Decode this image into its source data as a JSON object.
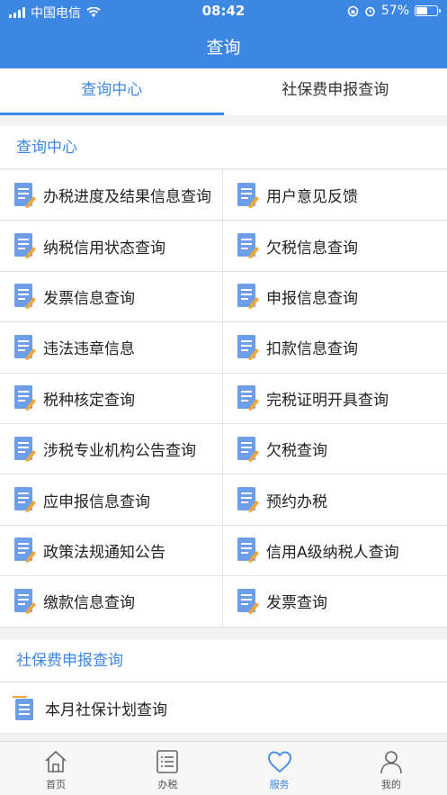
{
  "status_bar": {
    "carrier": "中国电信",
    "time": "08:42",
    "battery": "57%",
    "battery_level": 0.57
  },
  "header": {
    "title": "查询"
  },
  "tabs": [
    {
      "label": "查询中心",
      "active": true
    },
    {
      "label": "社保费申报查询",
      "active": false
    }
  ],
  "section1": {
    "title": "查询中心",
    "items": [
      "办税进度及结果信息查询",
      "用户意见反馈",
      "纳税信用状态查询",
      "欠税信息查询",
      "发票信息查询",
      "申报信息查询",
      "违法违章信息",
      "扣款信息查询",
      "税种核定查询",
      "完税证明开具查询",
      "涉税专业机构公告查询",
      "欠税查询",
      "应申报信息查询",
      "预约办税",
      "政策法规通知公告",
      "信用A级纳税人查询",
      "缴款信息查询",
      "发票查询"
    ]
  },
  "section2": {
    "title": "社保费申报查询",
    "items": [
      "本月社保计划查询"
    ]
  },
  "tabbar": [
    {
      "label": "首页",
      "icon": "home-icon"
    },
    {
      "label": "办税",
      "icon": "list-icon"
    },
    {
      "label": "服务",
      "icon": "heart-icon",
      "active": true
    },
    {
      "label": "我的",
      "icon": "user-icon"
    }
  ],
  "colors": {
    "primary": "#3d87e4",
    "icon_blue": "#6c9fe8",
    "icon_orange": "#f0a63a"
  }
}
